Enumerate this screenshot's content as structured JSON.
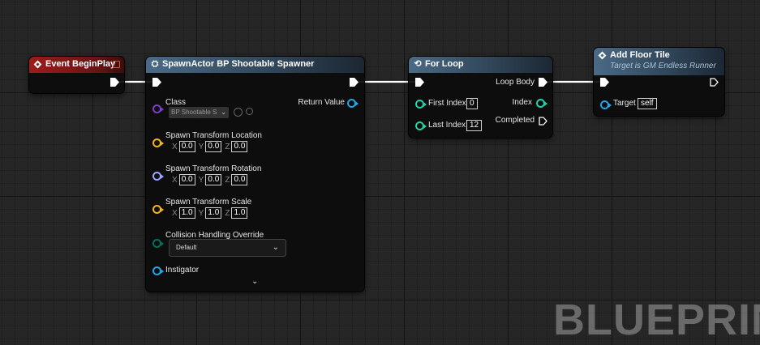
{
  "colors": {
    "exec": "#ffffff",
    "class_pin": "#7b3ec4",
    "struct_pin": "#f4b21d",
    "rotator_pin": "#9aa5ff",
    "object_pin": "#22a4e8",
    "int_pin": "#1ed3a8",
    "byte_pin": "#0b6b5b"
  },
  "event_begin_play": {
    "title": "Event BeginPlay",
    "icon": "event-diamond-icon"
  },
  "spawn_actor": {
    "title": "SpawnActor BP Shootable Spawner",
    "icon": "spawn-function-icon",
    "class_label": "Class",
    "class_value": "BP Shootable S",
    "location_label": "Spawn Transform Location",
    "location": {
      "x": "0.0",
      "y": "0.0",
      "z": "0.0"
    },
    "rotation_label": "Spawn Transform Rotation",
    "rotation": {
      "x": "0.0",
      "y": "0.0",
      "z": "0.0"
    },
    "scale_label": "Spawn Transform Scale",
    "scale": {
      "x": "1.0",
      "y": "1.0",
      "z": "1.0"
    },
    "collision_label": "Collision Handling Override",
    "collision_value": "Default",
    "instigator_label": "Instigator",
    "return_label": "Return Value",
    "axis": {
      "x": "X",
      "y": "Y",
      "z": "Z"
    }
  },
  "for_loop": {
    "title": "For Loop",
    "icon": "loop-icon",
    "first_index_label": "First Index",
    "first_index_value": "0",
    "last_index_label": "Last Index",
    "last_index_value": "12",
    "loop_body_label": "Loop Body",
    "index_label": "Index",
    "completed_label": "Completed"
  },
  "add_floor_tile": {
    "title": "Add Floor Tile",
    "subtitle": "Target is GM Endless Runner",
    "icon": "function-diamond-icon",
    "target_label": "Target",
    "target_value": "self"
  },
  "watermark": "BLUEPRIN"
}
